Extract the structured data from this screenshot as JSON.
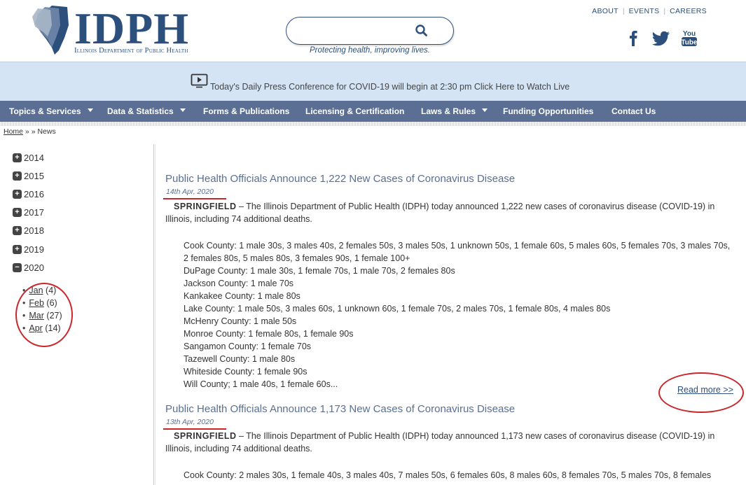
{
  "header": {
    "logo_text": "IDPH",
    "logo_subtitle": "Illinois Department of Public Health",
    "search_placeholder": "",
    "tagline": "Protecting health, improving lives.",
    "top_links": [
      "ABOUT",
      "EVENTS",
      "CAREERS"
    ],
    "social": [
      "facebook-icon",
      "twitter-icon",
      "youtube-icon"
    ],
    "brand_color": "#2c4f7c"
  },
  "banner": {
    "text": "Today's Daily Press Conference for COVID-19 will begin at 2:30 pm Click Here to Watch Live",
    "icon": "video-play-icon",
    "bg_color": "#d4e4f4"
  },
  "nav": {
    "items": [
      {
        "label": "Topics & Services",
        "dropdown": true
      },
      {
        "label": "Data & Statistics",
        "dropdown": true
      },
      {
        "label": "Forms & Publications",
        "dropdown": false
      },
      {
        "label": "Licensing & Certification",
        "dropdown": false
      },
      {
        "label": "Laws & Rules",
        "dropdown": true
      },
      {
        "label": "Funding Opportunities",
        "dropdown": false
      },
      {
        "label": "Contact Us",
        "dropdown": false
      }
    ],
    "bg_color": "#5b6f94"
  },
  "breadcrumb": {
    "home": "Home",
    "separator": " » » ",
    "current": "News"
  },
  "sidebar": {
    "years": [
      {
        "label": "2014",
        "expanded": false
      },
      {
        "label": "2015",
        "expanded": false
      },
      {
        "label": "2016",
        "expanded": false
      },
      {
        "label": "2017",
        "expanded": false
      },
      {
        "label": "2018",
        "expanded": false
      },
      {
        "label": "2019",
        "expanded": false
      },
      {
        "label": "2020",
        "expanded": true
      }
    ],
    "months": [
      {
        "label": "Jan",
        "count": "(4)"
      },
      {
        "label": "Feb",
        "count": "(6)"
      },
      {
        "label": "Mar",
        "count": "(27)"
      },
      {
        "label": "Apr",
        "count": "(14)"
      }
    ]
  },
  "articles": [
    {
      "title": "Public Health Officials Announce 1,222 New Cases of Coronavirus Disease",
      "date": "14th Apr, 2020",
      "city": "SPRINGFIELD",
      "lead": " – The Illinois Department of Public Health (IDPH) today announced 1,222 new cases of coronavirus disease (COVID-19) in Illinois, including 74 additional deaths.",
      "counties": [
        "Cook County: 1 male 30s, 3 males 40s, 2 females 50s, 3 males 50s, 1 unknown 50s, 1 female 60s, 5 males 60s, 5 females 70s, 3 males 70s, 2 females 80s, 5 males 80s, 3 females 90s, 1 female 100+",
        "DuPage County: 1 male 30s, 1 female 70s, 1 male 70s, 2 females 80s",
        "Jackson County: 1 male 70s",
        "Kankakee County: 1 male 80s",
        "Lake County: 1 male 50s, 3 males 60s, 1 unknown 60s, 1 female 70s, 2 males 70s, 1 female 80s, 4 males 80s",
        "McHenry County: 1 male 50s",
        "Monroe County: 1 female 80s, 1 female 90s",
        "Sangamon County: 1 female 70s",
        "Tazewell County: 1 male 80s",
        "Whiteside County: 1 female 90s",
        "Will County; 1 male 40s, 1 female 60s..."
      ],
      "read_more": "Read more >>"
    },
    {
      "title": "Public Health Officials Announce 1,173 New Cases of Coronavirus Disease",
      "date": "13th Apr, 2020",
      "city": "SPRINGFIELD",
      "lead": " – The Illinois Department of Public Health (IDPH) today announced 1,173 new cases of coronavirus disease (COVID-19) in Illinois, including 74 additional deaths.",
      "counties": [
        "Cook County: 2 males 30s, 1 female 40s, 3 males 40s, 7 males 50s, 6 females 60s, 8 males 60s, 8 females 70s, 5 males 70s, 8 females"
      ]
    }
  ],
  "annotation_color": "#c8262b"
}
